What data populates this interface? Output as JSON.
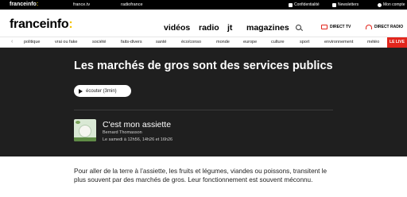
{
  "topbar": {
    "logo_text": "franceinfo",
    "logo_colon": ":",
    "links": [
      "france.tv",
      "radiofrance"
    ],
    "account": [
      {
        "label": "Confidentialité",
        "icon": "privacy-icon"
      },
      {
        "label": "Newsletters",
        "icon": "mail-icon"
      },
      {
        "label": "Mon compte",
        "icon": "user-icon"
      }
    ]
  },
  "header": {
    "brand": "franceinfo",
    "brand_colon": ":",
    "nav": [
      "vidéos",
      "radio",
      "jt",
      "magazines"
    ],
    "direct_tv": "DIRECT TV",
    "direct_radio": "DIRECT RADIO"
  },
  "categories": {
    "items": [
      "politique",
      "vrai ou fake",
      "société",
      "faits-divers",
      "santé",
      "éco/conso",
      "monde",
      "europe",
      "culture",
      "sport",
      "environnement",
      "météo"
    ],
    "live": "LE LIVE"
  },
  "hero": {
    "title": "Les marchés de gros sont des services publics",
    "listen_label": "écouter (3min)",
    "show_title": "C'est mon assiette",
    "show_author": "Bernard Thomasson",
    "show_schedule": "Le samedi à 12h56, 14h26 et 16h26"
  },
  "article": {
    "lead": "Pour aller de la terre à l’assiette, les fruits et légumes, viandes ou poissons, transitent le plus souvent par des marchés de gros. Leur fonctionnement est souvent méconnu."
  },
  "colors": {
    "accent_yellow": "#f5c400",
    "live_red": "#e2261d",
    "hero_bg": "#1f1f1f"
  }
}
